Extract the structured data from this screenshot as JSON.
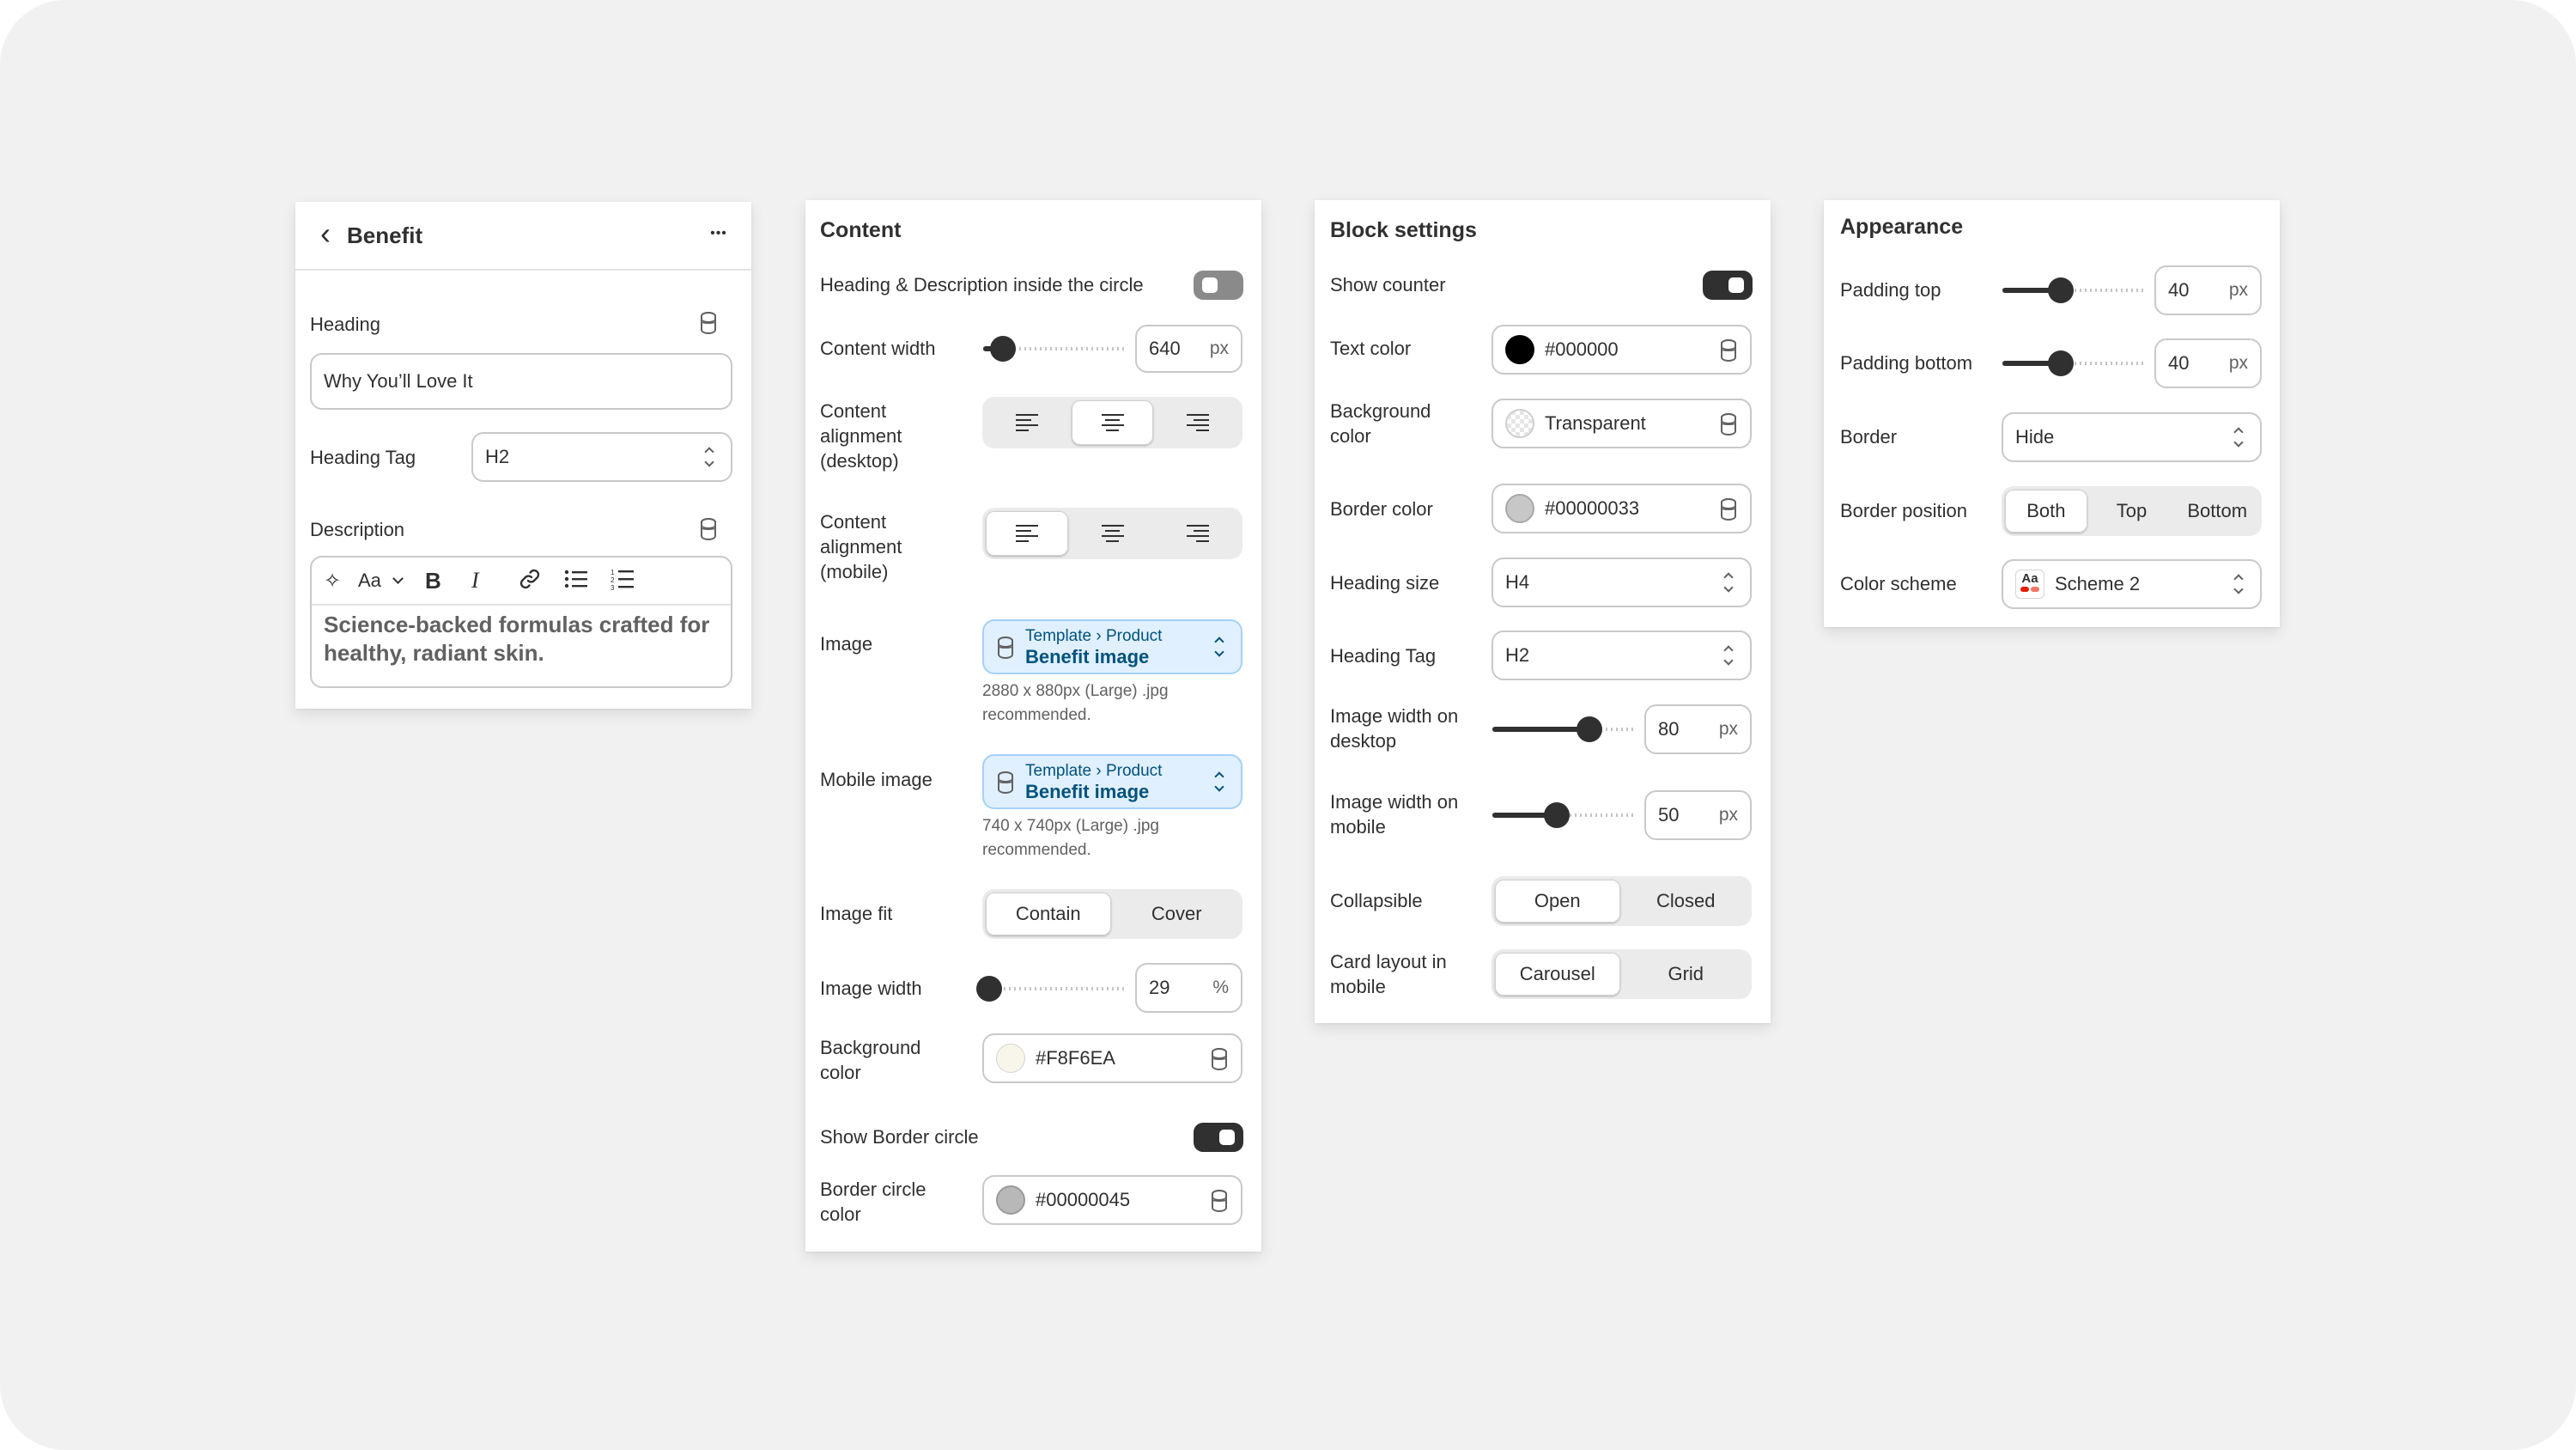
{
  "benefit": {
    "back": "‹",
    "title": "Benefit",
    "more": "•••",
    "heading_label": "Heading",
    "heading_value": "Why You’ll Love It",
    "heading_tag_label": "Heading Tag",
    "heading_tag_value": "H2",
    "description_label": "Description",
    "toolbar": {
      "ai": "✧",
      "text_style": "Aa",
      "bold": "B",
      "italic": "I"
    },
    "description_value": "Science-backed formulas crafted for healthy, radiant skin."
  },
  "content": {
    "title": "Content",
    "inside_circle_label": "Heading & Description inside the circle",
    "inside_circle_on": false,
    "content_width_label": "Content width",
    "content_width_value": "640",
    "content_width_fraction": 0.14,
    "content_width_unit": "px",
    "align_desktop_label": "Content alignment (desktop)",
    "align_desktop_selected": "center",
    "align_mobile_label": "Content alignment (mobile)",
    "align_mobile_selected": "left",
    "image_label": "Image",
    "image_source": "Template › Product",
    "image_value": "Benefit image",
    "image_help": "2880 x 880px (Large) .jpg recommended.",
    "mobile_image_label": "Mobile image",
    "mobile_image_source": "Template › Product",
    "mobile_image_value": "Benefit image",
    "mobile_image_help": "740 x 740px (Large) .jpg recommended.",
    "image_fit_label": "Image fit",
    "image_fit_options": [
      "Contain",
      "Cover"
    ],
    "image_fit_selected": "Contain",
    "image_width_label": "Image width",
    "image_width_value": "29",
    "image_width_fraction": 0.04,
    "image_width_unit": "%",
    "bg_color_label": "Background color",
    "bg_color_value": "#F8F6EA",
    "bg_color_hex": "#F8F6EA",
    "show_border_label": "Show Border circle",
    "show_border_on": true,
    "border_circle_label": "Border circle color",
    "border_circle_value": "#00000045",
    "border_circle_hex": "#b8b8b8"
  },
  "block": {
    "title": "Block settings",
    "show_counter_label": "Show counter",
    "show_counter_on": true,
    "text_color_label": "Text color",
    "text_color_value": "#000000",
    "text_color_hex": "#000000",
    "bg_color_label": "Background color",
    "bg_color_value": "Transparent",
    "border_color_label": "Border color",
    "border_color_value": "#00000033",
    "border_color_hex": "#c7c7c7",
    "heading_size_label": "Heading size",
    "heading_size_value": "H4",
    "heading_tag_label": "Heading Tag",
    "heading_tag_value": "H2",
    "img_desktop_label": "Image width on desktop",
    "img_desktop_value": "80",
    "img_desktop_fraction": 0.68,
    "img_desktop_unit": "px",
    "img_mobile_label": "Image width on mobile",
    "img_mobile_value": "50",
    "img_mobile_fraction": 0.45,
    "img_mobile_unit": "px",
    "collapsible_label": "Collapsible",
    "collapsible_options": [
      "Open",
      "Closed"
    ],
    "collapsible_selected": "Open",
    "card_layout_label": "Card layout in mobile",
    "card_layout_options": [
      "Carousel",
      "Grid"
    ],
    "card_layout_selected": "Carousel"
  },
  "appearance": {
    "title": "Appearance",
    "padding_top_label": "Padding top",
    "padding_top_value": "40",
    "padding_top_fraction": 0.41,
    "padding_bottom_label": "Padding bottom",
    "padding_bottom_value": "40",
    "padding_bottom_fraction": 0.41,
    "unit": "px",
    "border_label": "Border",
    "border_value": "Hide",
    "border_position_label": "Border position",
    "border_position_options": [
      "Both",
      "Top",
      "Bottom"
    ],
    "border_position_selected": "Both",
    "color_scheme_label": "Color scheme",
    "color_scheme_icon_text": "Aa",
    "color_scheme_value": "Scheme 2"
  },
  "colors": {
    "toggle_on": "#303030",
    "toggle_off": "#8a8a8a",
    "dynamic_source_bg": "#e0f0ff",
    "dynamic_source_text": "#00527c"
  }
}
